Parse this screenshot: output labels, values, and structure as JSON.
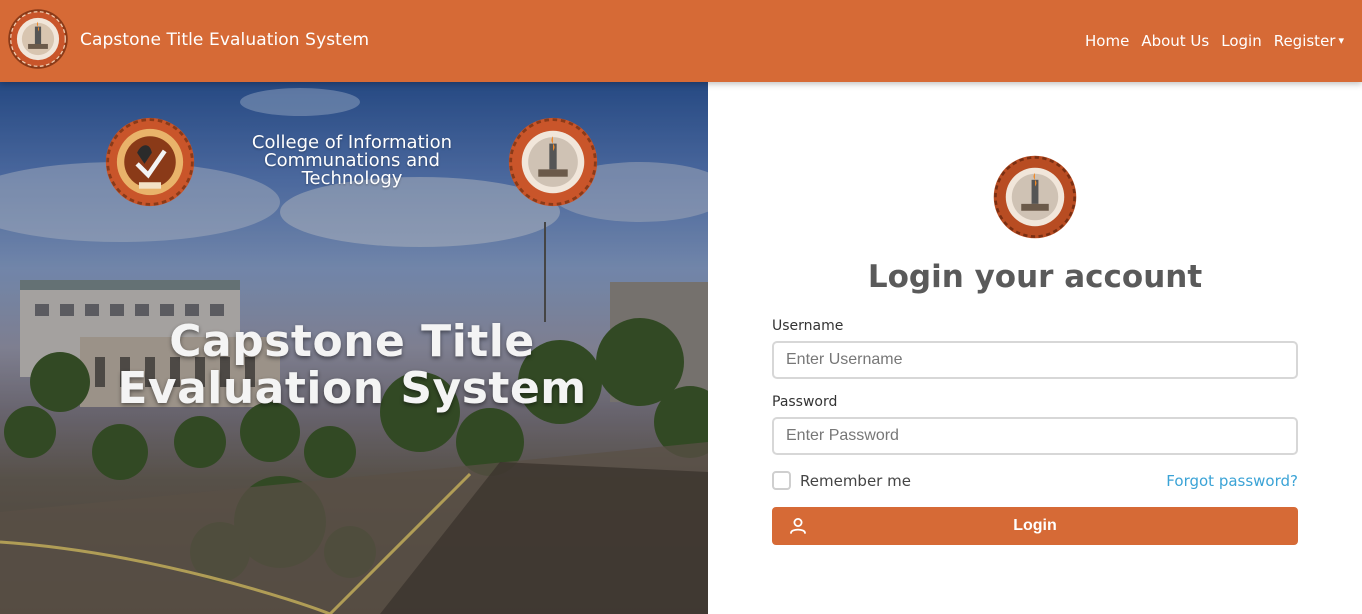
{
  "navbar": {
    "brand": "Capstone Title Evaluation System",
    "links": [
      {
        "label": "Home"
      },
      {
        "label": "About Us"
      },
      {
        "label": "Login"
      },
      {
        "label": "Register",
        "caret": "▾"
      }
    ]
  },
  "hero": {
    "college_line1": "College of Information",
    "college_line2": "Communations and",
    "college_line3": "Technology",
    "title_line1": "Capstone Title",
    "title_line2": "Evaluation System",
    "left_seal_text": "BULACAN STATE UNIVERSITY",
    "left_seal_year": "1904",
    "left_seal_bottom": "PHILIPPINES"
  },
  "login": {
    "heading": "Login your account",
    "username_label": "Username",
    "username_placeholder": "Enter Username",
    "username_value": "",
    "password_label": "Password",
    "password_placeholder": "Enter Password",
    "password_value": "",
    "remember_label": "Remember me",
    "remember_checked": false,
    "forgot_label": "Forgot password?",
    "button_label": "Login",
    "button_icon": "user-icon"
  },
  "colors": {
    "brand": "#d66a36",
    "link": "#3ba3d6",
    "heading": "#5a5a5a"
  }
}
